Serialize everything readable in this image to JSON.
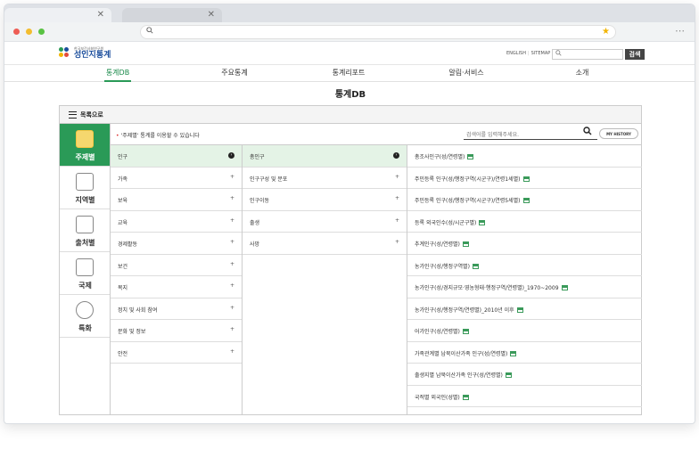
{
  "browser": {
    "tab_close": "✕",
    "address_icon": "search-icon",
    "bookmark_star": "★",
    "menu_dots": "⋯"
  },
  "header": {
    "logo_small": "한국보건사회연구원",
    "logo_big": "성인지통계",
    "util_english": "ENGLISH",
    "util_sitemap": "SITEMAP",
    "search_button": "검색"
  },
  "gnb": [
    "통계DB",
    "주요통계",
    "통계리포트",
    "알림·서비스",
    "소개"
  ],
  "page_title": "통계DB",
  "panel": {
    "list_toggle": "목록으로",
    "info_text": "'주제별' 통계를 이용할 수 있습니다",
    "search_placeholder": "검색어를 입력해주세요.",
    "my_history": "MY HISTORY",
    "side": [
      "주제별",
      "지역별",
      "출처별",
      "국제",
      "특화"
    ],
    "col1": [
      "인구",
      "가족",
      "보육",
      "교육",
      "경제활동",
      "보건",
      "복지",
      "정치 및 사회 참여",
      "문화 및 정보",
      "안전"
    ],
    "col2": [
      "총인구",
      "인구구성 및 분포",
      "인구이동",
      "출생",
      "사망"
    ],
    "col3": [
      "총조사인구(성/연령별)",
      "주민등록 인구(성/행정구역(시군구)/연령1세별)",
      "주민등록 인구(성/행정구역(시군구)/연령5세별)",
      "등록 외국인수(성/시군구별)",
      "추계인구(성/연령별)",
      "농가인구(성/행정구역별)",
      "농가인구(성/경지규모·영농형태·행정구역/연령별)_1970~2009",
      "농가인구(성/행정구역/연령별)_2010년 이후",
      "어가인구(성/연령별)",
      "가족관계별 남북이산가족 인구(성/연령별)",
      "출생지별 남북이산가족 인구(성/연령별)",
      "국적별 외국인(성별)"
    ],
    "plus": "+",
    "arrow": "›"
  },
  "colors": {
    "accent_green": "#2a9a57",
    "selected_bg": "#e4f3e6"
  }
}
